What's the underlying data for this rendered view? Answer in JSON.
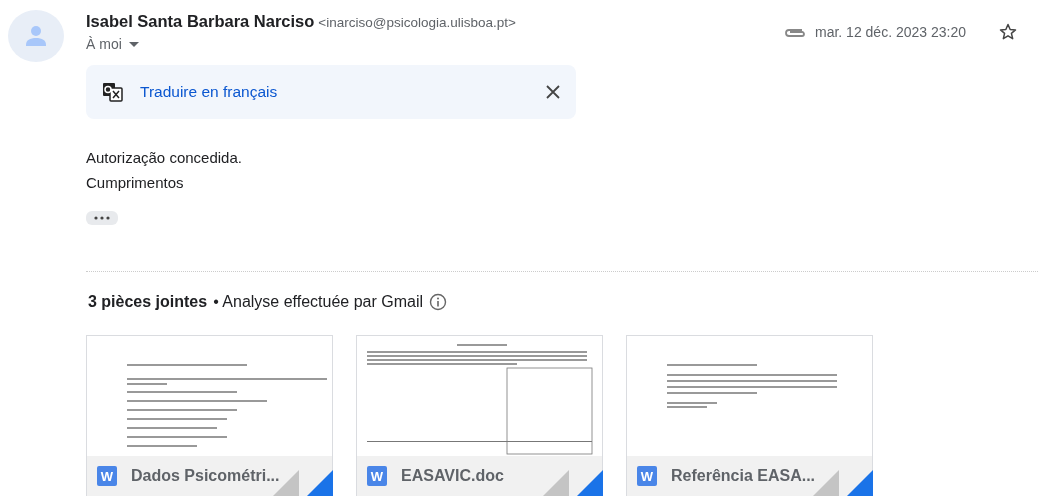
{
  "sender": {
    "name": "Isabel Santa Barbara Narciso",
    "email": "<inarciso@psicologia.ulisboa.pt>",
    "recipients": "À moi"
  },
  "header": {
    "date": "mar. 12 déc. 2023 23:20",
    "has_attachment": true,
    "starred": false
  },
  "translate_banner": {
    "link": "Traduire en français"
  },
  "body": [
    "Autorização concedida.",
    "Cumprimentos"
  ],
  "attachments_header": {
    "count": "3 pièces jointes",
    "scan_note": "• Analyse effectuée par Gmail"
  },
  "attachments": [
    {
      "icon_letter": "W",
      "filename": "Dados Psicométri..."
    },
    {
      "icon_letter": "W",
      "filename": "EASAVIC.doc"
    },
    {
      "icon_letter": "W",
      "filename": "Referência EASA..."
    }
  ]
}
